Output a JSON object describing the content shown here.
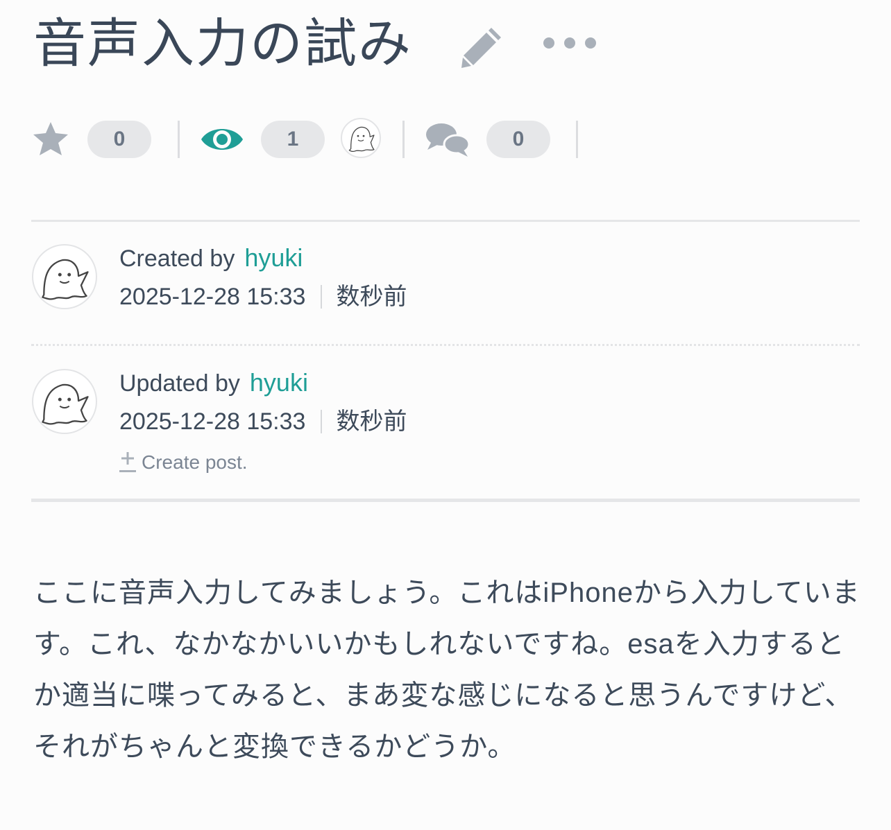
{
  "post": {
    "title": "音声入力の試み",
    "body": "ここに音声入力してみましょう。これはiPhoneから入力しています。これ、なかなかいいかもしれないですね。esaを入力するとか適当に喋ってみると、まあ変な感じになると思うんですけど、それがちゃんと変換できるかどうか。"
  },
  "stats": {
    "stars": "0",
    "watchers": "1",
    "comments": "0"
  },
  "icons": {
    "edit": "pencil-icon",
    "more": "more-dots-icon",
    "star": "star-icon",
    "watch": "eye-icon",
    "comments": "comments-icon",
    "avatar": "ghost-avatar-icon",
    "revision": "diff-plus-minus-icon"
  },
  "created": {
    "label": "Created by",
    "user": "hyuki",
    "datetime": "2025-12-28 15:33",
    "relative": "数秒前"
  },
  "updated": {
    "label": "Updated by",
    "user": "hyuki",
    "datetime": "2025-12-28 15:33",
    "relative": "数秒前",
    "revision_message": "Create post."
  },
  "colors": {
    "accent": "#1f9e96",
    "icon_gray": "#a9b0b9",
    "text": "#3d4a5a"
  }
}
